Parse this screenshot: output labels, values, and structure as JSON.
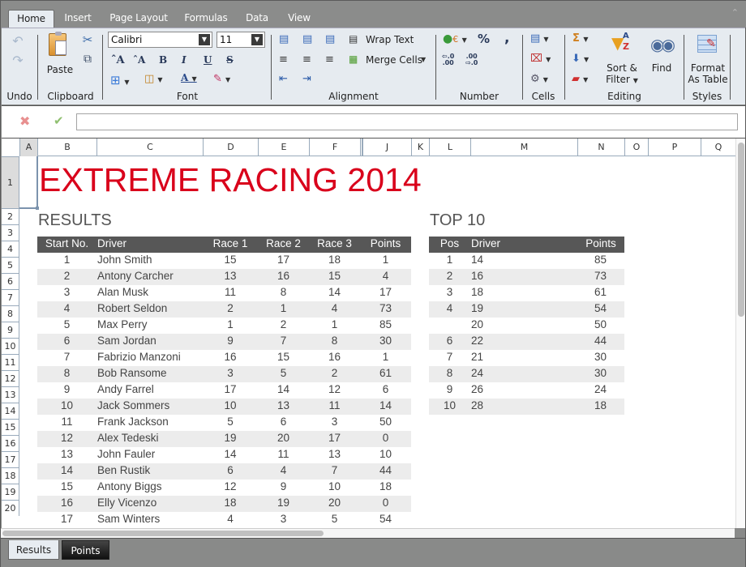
{
  "ribbon_tabs": [
    "Home",
    "Insert",
    "Page Layout",
    "Formulas",
    "Data",
    "View"
  ],
  "active_tab": "Home",
  "groups": {
    "undo": {
      "label": "Undo"
    },
    "clipboard": {
      "label": "Clipboard",
      "paste": "Paste"
    },
    "font": {
      "label": "Font",
      "font_name": "Calibri",
      "font_size": "11"
    },
    "alignment": {
      "label": "Alignment",
      "wrap_text": "Wrap Text",
      "merge_cells": "Merge Cells"
    },
    "number": {
      "label": "Number",
      "percent": "%",
      "comma": ","
    },
    "cells": {
      "label": "Cells"
    },
    "editing": {
      "label": "Editing",
      "sort_filter_1": "Sort &",
      "sort_filter_2": "Filter",
      "find": "Find"
    },
    "styles": {
      "label": "Styles",
      "format_table_1": "Format",
      "format_table_2": "As Table"
    }
  },
  "formula_bar": {
    "value": ""
  },
  "columns": [
    "A",
    "B",
    "C",
    "D",
    "E",
    "F",
    "J",
    "K",
    "L",
    "M",
    "N",
    "O",
    "P",
    "Q"
  ],
  "rows": [
    "1",
    "2",
    "3",
    "4",
    "5",
    "6",
    "7",
    "8",
    "9",
    "10",
    "11",
    "12",
    "13",
    "14",
    "15",
    "16",
    "17",
    "18",
    "19",
    "20"
  ],
  "title": "EXTREME RACING 2014",
  "title_color": "#d9001b",
  "results": {
    "heading": "RESULTS",
    "headers": [
      "Start No.",
      "Driver",
      "Race 1",
      "Race 2",
      "Race 3",
      "Points"
    ],
    "rows": [
      [
        "1",
        "John Smith",
        "15",
        "17",
        "18",
        "1"
      ],
      [
        "2",
        "Antony Carcher",
        "13",
        "16",
        "15",
        "4"
      ],
      [
        "3",
        "Alan Musk",
        "11",
        "8",
        "14",
        "17"
      ],
      [
        "4",
        "Robert Seldon",
        "2",
        "1",
        "4",
        "73"
      ],
      [
        "5",
        "Max Perry",
        "1",
        "2",
        "1",
        "85"
      ],
      [
        "6",
        "Sam Jordan",
        "9",
        "7",
        "8",
        "30"
      ],
      [
        "7",
        "Fabrizio Manzoni",
        "16",
        "15",
        "16",
        "1"
      ],
      [
        "8",
        "Bob Ransome",
        "3",
        "5",
        "2",
        "61"
      ],
      [
        "9",
        "Andy Farrel",
        "17",
        "14",
        "12",
        "6"
      ],
      [
        "10",
        "Jack Sommers",
        "10",
        "13",
        "11",
        "14"
      ],
      [
        "11",
        "Frank Jackson",
        "5",
        "6",
        "3",
        "50"
      ],
      [
        "12",
        "Alex Tedeski",
        "19",
        "20",
        "17",
        "0"
      ],
      [
        "13",
        "John Fauler",
        "14",
        "11",
        "13",
        "10"
      ],
      [
        "14",
        "Ben Rustik",
        "6",
        "4",
        "7",
        "44"
      ],
      [
        "15",
        "Antony Biggs",
        "12",
        "9",
        "10",
        "18"
      ],
      [
        "16",
        "Elly Vicenzo",
        "18",
        "19",
        "20",
        "0"
      ],
      [
        "17",
        "Sam Winters",
        "4",
        "3",
        "5",
        "54"
      ]
    ]
  },
  "top10": {
    "heading": "TOP 10",
    "headers": [
      "Pos",
      "Driver",
      "Points"
    ],
    "rows": [
      [
        "1",
        "14",
        "85"
      ],
      [
        "2",
        "16",
        "73"
      ],
      [
        "3",
        "18",
        "61"
      ],
      [
        "4",
        "19",
        "54"
      ],
      [
        "",
        "20",
        "50"
      ],
      [
        "6",
        "22",
        "44"
      ],
      [
        "7",
        "21",
        "30"
      ],
      [
        "8",
        "24",
        "30"
      ],
      [
        "9",
        "26",
        "24"
      ],
      [
        "10",
        "28",
        "18"
      ]
    ]
  },
  "sheet_tabs": [
    "Results",
    "Points"
  ],
  "active_sheet": "Results"
}
